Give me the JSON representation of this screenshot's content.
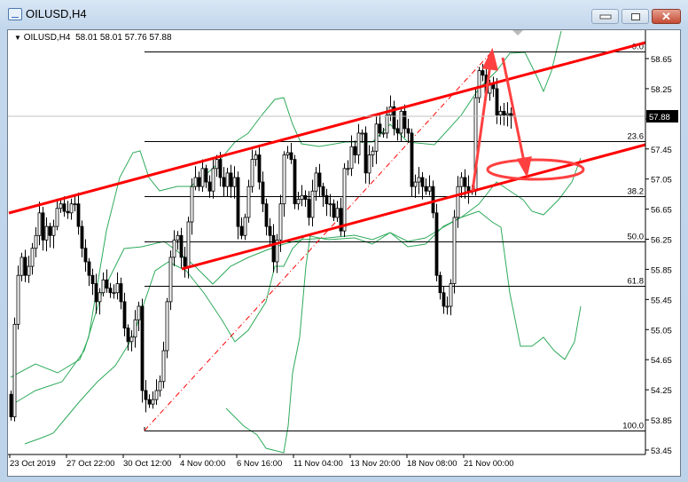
{
  "window": {
    "title": "OILUSD,H4"
  },
  "chart_header": {
    "symbol": "OILUSD,H4",
    "open": "58.01",
    "high": "58.01",
    "low": "57.76",
    "close": "57.88"
  },
  "current_price": "57.88",
  "colors": {
    "channel": "#ff0000",
    "bands": "#2eaa5a",
    "candle": "#000000"
  },
  "price_axis": [
    "58.65",
    "58.25",
    "57.85",
    "57.45",
    "57.05",
    "56.65",
    "56.25",
    "55.85",
    "55.45",
    "55.05",
    "54.65",
    "54.25",
    "53.85",
    "53.45"
  ],
  "time_axis": [
    "23 Oct 2019",
    "27 Oct 22:00",
    "30 Oct 12:00",
    "4 Nov 00:00",
    "6 Nov 16:00",
    "11 Nov 04:00",
    "13 Nov 20:00",
    "18 Nov 08:00",
    "21 Nov 00:00"
  ],
  "fibonacci": [
    {
      "label": "0.0",
      "price": 58.74
    },
    {
      "label": "23.6",
      "price": 57.55
    },
    {
      "label": "38.2",
      "price": 56.82
    },
    {
      "label": "50.0",
      "price": 56.22
    },
    {
      "label": "61.8",
      "price": 55.63
    },
    {
      "label": "100.0",
      "price": 53.71
    }
  ],
  "chart_data": {
    "type": "candlestick",
    "symbol": "OILUSD",
    "timeframe": "H4",
    "ylim": [
      53.4,
      59.0
    ],
    "closes": [
      53.89,
      55.12,
      55.77,
      56.01,
      55.77,
      55.89,
      56.13,
      56.3,
      56.6,
      56.24,
      56.42,
      56.3,
      56.42,
      56.66,
      56.72,
      56.62,
      56.6,
      56.72,
      56.72,
      56.42,
      56.13,
      55.95,
      55.77,
      55.66,
      55.42,
      55.54,
      55.71,
      55.6,
      55.54,
      55.54,
      55.66,
      55.42,
      55.07,
      54.89,
      54.95,
      55.18,
      55.36,
      54.24,
      54.12,
      54.06,
      54.12,
      54.24,
      54.36,
      54.77,
      55.42,
      56.01,
      56.24,
      56.3,
      56.01,
      55.89,
      56.48,
      56.95,
      57.07,
      56.95,
      57.19,
      57.01,
      56.89,
      57.19,
      57.31,
      57.07,
      56.95,
      57.13,
      56.95,
      57.07,
      56.42,
      56.3,
      56.54,
      56.95,
      57.31,
      57.37,
      57.01,
      56.72,
      56.42,
      56.3,
      55.95,
      56.24,
      56.72,
      57.37,
      57.4,
      57.31,
      56.72,
      56.78,
      56.83,
      56.78,
      56.54,
      56.89,
      57.13,
      56.95,
      56.83,
      56.72,
      56.72,
      56.54,
      56.66,
      56.36,
      57.19,
      57.19,
      57.48,
      57.37,
      57.66,
      57.66,
      57.13,
      57.37,
      57.42,
      57.78,
      57.66,
      57.66,
      57.9,
      58.01,
      57.72,
      57.66,
      57.95,
      57.72,
      57.66,
      56.95,
      57.01,
      57.07,
      56.95,
      56.89,
      56.95,
      56.6,
      55.77,
      55.54,
      55.36,
      55.36,
      55.66,
      56.54,
      56.95,
      57.07,
      56.95,
      56.89,
      56.89,
      58.13,
      58.49,
      58.43,
      58.19,
      58.31,
      58.25,
      57.9,
      57.95,
      57.9,
      57.92,
      57.88
    ]
  }
}
